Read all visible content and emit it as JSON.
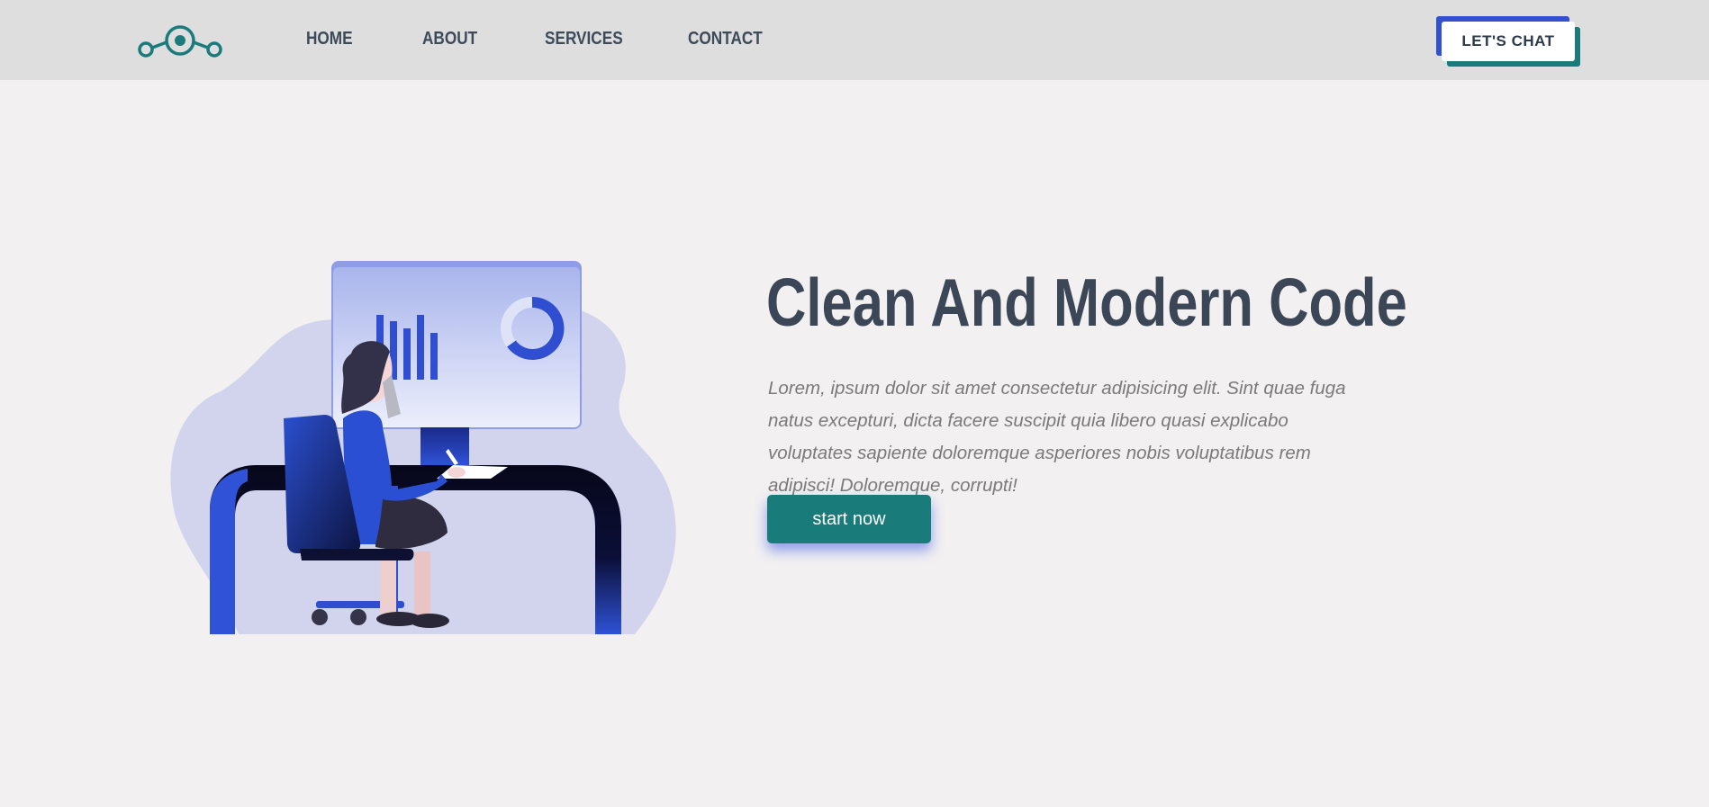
{
  "header": {
    "logo_icon": "connected-nodes-logo",
    "nav": [
      "HOME",
      "ABOUT",
      "SERVICES",
      "CONTACT"
    ],
    "chat_button": "LET'S CHAT"
  },
  "hero": {
    "title": "Clean And Modern Code",
    "text": "Lorem, ipsum dolor sit amet consectetur adipisicing elit. Sint quae fuga natus excepturi, dicta facere suscipit quia libero quasi explicabo voluptates sapiente doloremque asperiores nobis voluptatibus rem adipisci! Doloremque, corrupti!",
    "cta": "start now",
    "illustration": "woman-at-desk-with-monitor"
  },
  "colors": {
    "accent_teal": "#1a7b7b",
    "accent_blue": "#3151d1",
    "heading": "#3b4656",
    "header_bg": "#dedede",
    "page_bg": "#f2f0f1"
  }
}
